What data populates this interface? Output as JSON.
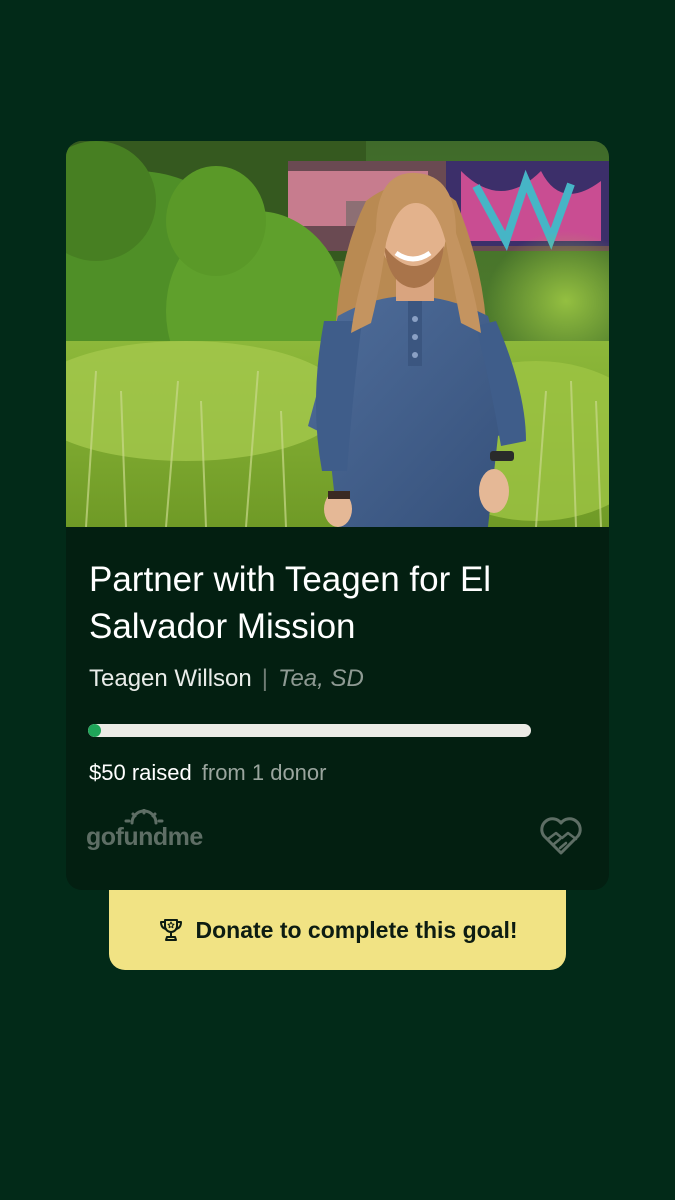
{
  "fundraiser": {
    "title": "Partner with Teagen  for El Salvador Mission",
    "organizer": "Teagen  Willson",
    "separator": "|",
    "location": "Tea, SD",
    "raised_amount": "$50 raised",
    "donor_count_text": "from 1 donor",
    "progress_fraction": 0.02
  },
  "brand": {
    "logo_text": "gofundme",
    "icon": "heart-hands-icon"
  },
  "cta": {
    "label": "Donate to complete this goal!",
    "icon": "trophy-icon"
  },
  "colors": {
    "background": "#022a18",
    "card": "#031f11",
    "progress": "#1fa559",
    "cta": "#f1e384"
  }
}
